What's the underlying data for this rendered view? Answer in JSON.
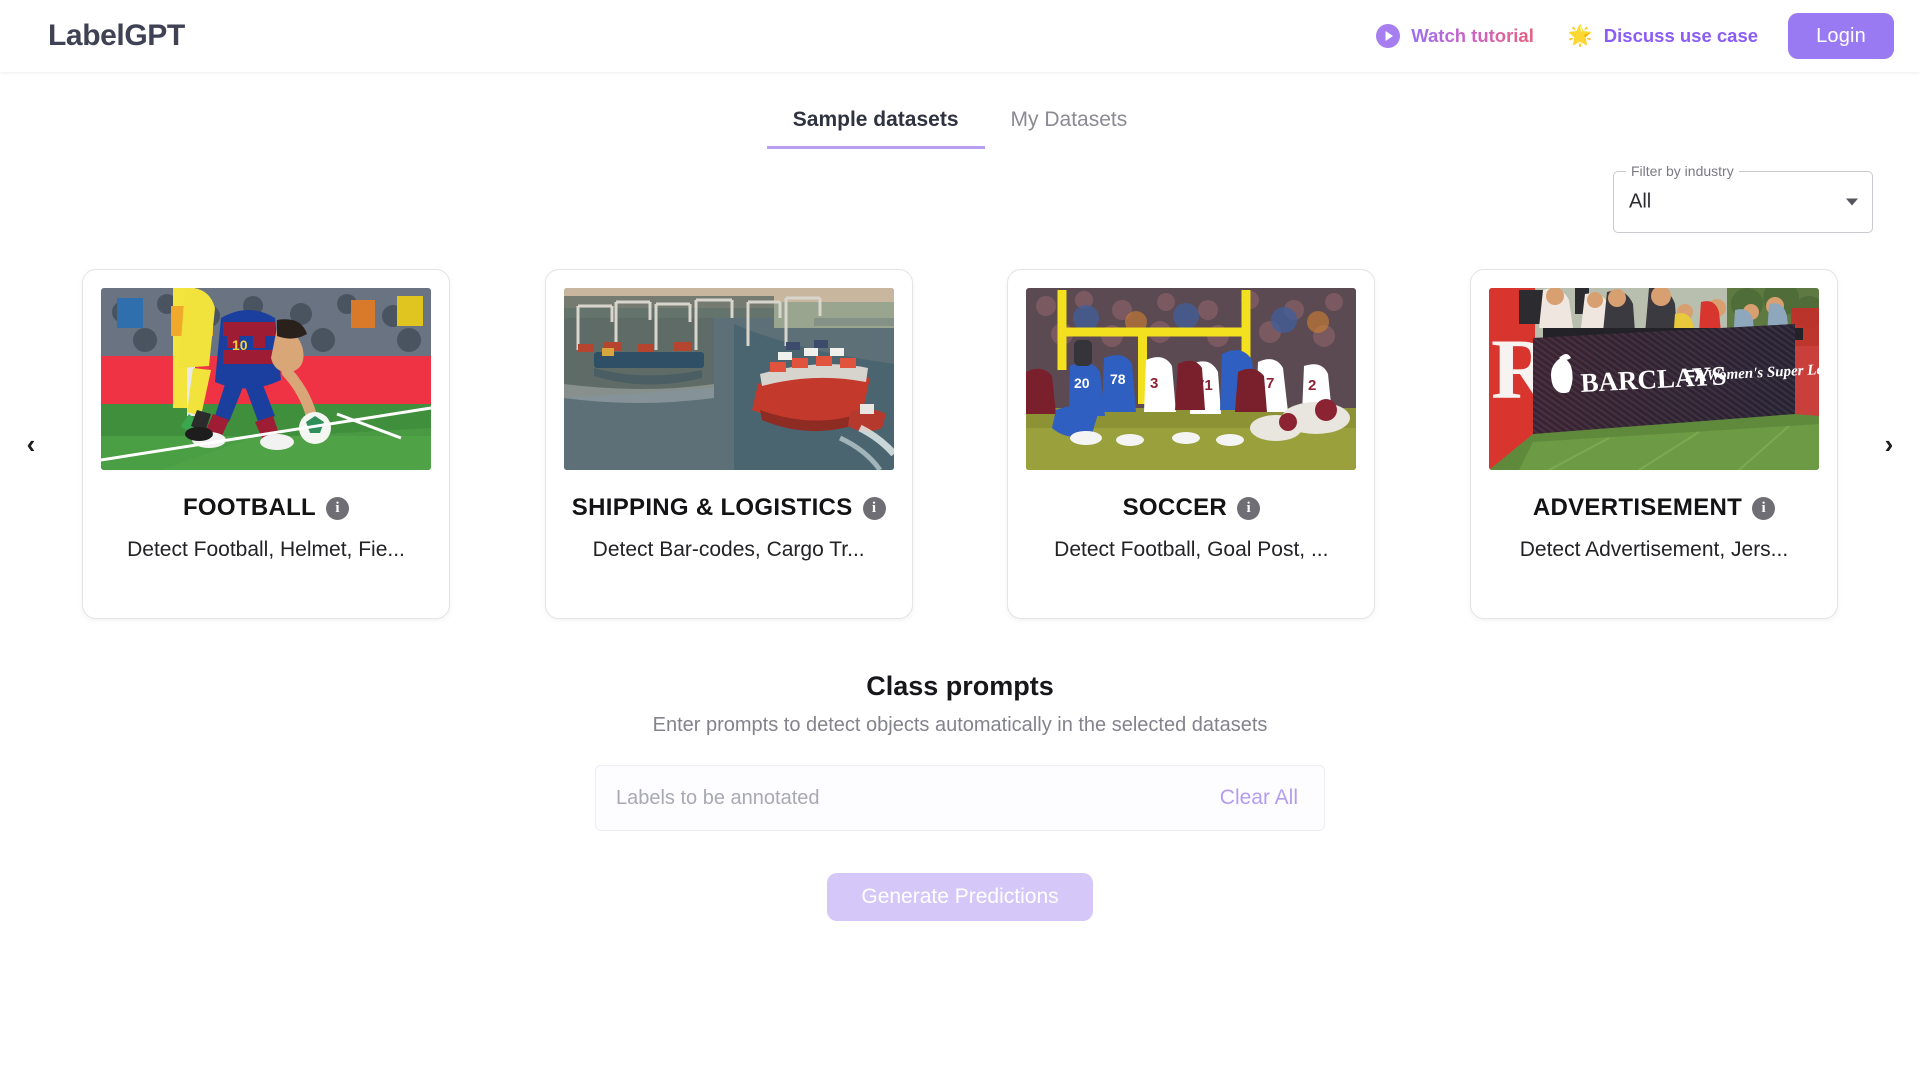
{
  "header": {
    "logo": "LabelGPT",
    "watch_tutorial": "Watch tutorial",
    "play_icon": "play-circle-icon",
    "discuss_use_case": "Discuss use case",
    "sparkle_icon": "shooting-star-icon",
    "login": "Login",
    "accent_purple": "#8b5cf6",
    "login_bg": "#9a7af2"
  },
  "tabs": [
    {
      "label": "Sample datasets",
      "active": true
    },
    {
      "label": "My Datasets",
      "active": false
    }
  ],
  "filter": {
    "label": "Filter by industry",
    "value": "All",
    "options": [
      "All"
    ]
  },
  "carousel": {
    "prev_icon": "chevron-left-icon",
    "next_icon": "chevron-right-icon",
    "prev_glyph": "‹",
    "next_glyph": "›"
  },
  "cards": [
    {
      "title": "FOOTBALL",
      "description": "Detect Football, Helmet, Fie...",
      "info_icon": "info-icon",
      "image_alt": "soccer-player-placing-ball-on-pitch"
    },
    {
      "title": "SHIPPING & LOGISTICS",
      "description": "Detect Bar-codes, Cargo Tr...",
      "info_icon": "info-icon",
      "image_alt": "aerial-view-of-container-ship-at-port"
    },
    {
      "title": "SOCCER",
      "description": "Detect Football, Goal Post, ...",
      "info_icon": "info-icon",
      "image_alt": "american-football-field-goal-attempt"
    },
    {
      "title": "ADVERTISEMENT",
      "description": "Detect Advertisement, Jers...",
      "info_icon": "info-icon",
      "image_alt": "barclays-fa-womens-super-league-led-board"
    }
  ],
  "prompts": {
    "title": "Class prompts",
    "subtitle": "Enter prompts to detect objects automatically in the selected datasets",
    "input_value": "",
    "input_placeholder": "Labels to be annotated",
    "clear_all": "Clear All",
    "generate": "Generate Predictions",
    "generate_bg": "#d5c7f7"
  }
}
